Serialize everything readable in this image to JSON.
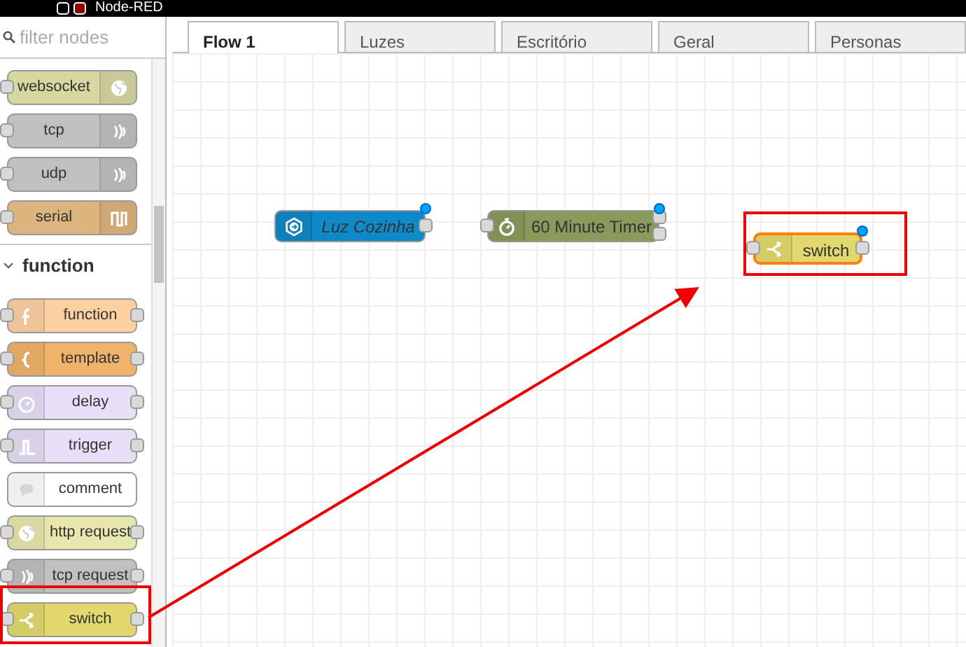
{
  "header": {
    "title": "Node-RED"
  },
  "palette": {
    "filter": {
      "placeholder": "filter nodes"
    },
    "groups": [
      {
        "nodes": [
          {
            "label": "websocket",
            "color": "#d7d7a0",
            "kind": "websocket",
            "has_input": true,
            "has_output": false
          },
          {
            "label": "tcp",
            "color": "#c0c0c0",
            "kind": "tcp",
            "has_input": true,
            "has_output": false
          },
          {
            "label": "udp",
            "color": "#c0c0c0",
            "kind": "udp",
            "has_input": true,
            "has_output": false
          },
          {
            "label": "serial",
            "color": "#dbb47e",
            "kind": "serial",
            "has_input": true,
            "has_output": false
          }
        ]
      },
      {
        "category": "function",
        "expanded": true,
        "nodes": [
          {
            "label": "function",
            "color": "#fdd0a2",
            "kind": "function",
            "has_input": true,
            "has_output": true
          },
          {
            "label": "template",
            "color": "#f0b36b",
            "kind": "template",
            "has_input": true,
            "has_output": true
          },
          {
            "label": "delay",
            "color": "#e6e0f8",
            "kind": "delay",
            "has_input": true,
            "has_output": true
          },
          {
            "label": "trigger",
            "color": "#e6e0f8",
            "kind": "trigger",
            "has_input": true,
            "has_output": true
          },
          {
            "label": "comment",
            "color": "#ffffff",
            "kind": "comment",
            "has_input": false,
            "has_output": false
          },
          {
            "label": "http request",
            "color": "#e7e7ae",
            "kind": "http",
            "has_input": true,
            "has_output": true
          },
          {
            "label": "tcp request",
            "color": "#c0c0c0",
            "kind": "tcprequest",
            "has_input": true,
            "has_output": true
          },
          {
            "label": "switch",
            "color": "#e2d96e",
            "kind": "switch",
            "has_input": true,
            "has_output": true
          }
        ]
      }
    ]
  },
  "tabs": [
    {
      "label": "Flow 1",
      "selected": true
    },
    {
      "label": "Luzes",
      "selected": false
    },
    {
      "label": "Escritório",
      "selected": false
    },
    {
      "label": "Geral",
      "selected": false
    },
    {
      "label": "Personas",
      "selected": false
    }
  ],
  "flow_nodes": [
    {
      "label": "Luz Cozinha",
      "color": "#0f8ac9",
      "kind": "link",
      "has_input": false,
      "changed": true,
      "selected": false
    },
    {
      "label": "60 Minute Timer",
      "color": "#8a9a5b",
      "kind": "timer",
      "has_input": true,
      "changed": true,
      "selected": false
    },
    {
      "label": "switch",
      "color": "#e2d96e",
      "kind": "switch",
      "has_input": true,
      "changed": true,
      "selected": true
    }
  ]
}
